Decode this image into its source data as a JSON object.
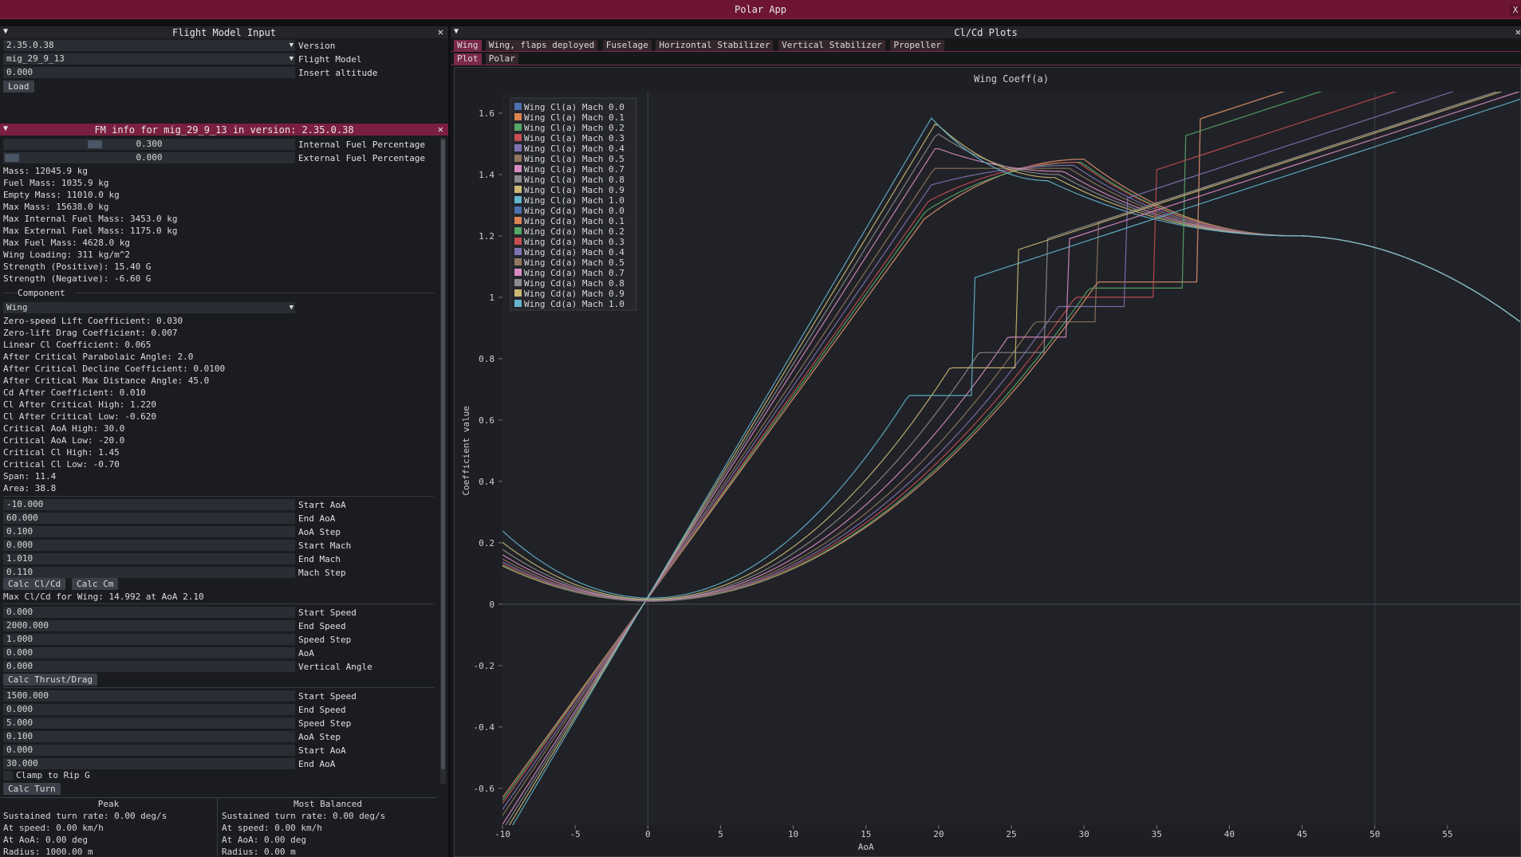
{
  "app": {
    "title": "Polar App",
    "close_glyph": "X"
  },
  "input_panel": {
    "title": "Flight Model Input",
    "version_value": "2.35.0.38",
    "version_label": "Version",
    "fm_value": "mig_29_9_13",
    "fm_label": "Flight Model",
    "altitude_value": "0.000",
    "altitude_label": "Insert altitude",
    "load_label": "Load"
  },
  "fm_panel": {
    "title": "FM info for mig_29_9_13 in version: 2.35.0.38",
    "internal_fuel_value": "0.300",
    "internal_fuel_fraction": 0.3,
    "internal_fuel_label": "Internal Fuel Percentage",
    "external_fuel_value": "0.000",
    "external_fuel_fraction": 0.0,
    "external_fuel_label": "External Fuel Percentage",
    "stats": [
      "Mass: 12045.9 kg",
      "Fuel Mass: 1035.9 kg",
      "Empty Mass: 11010.0 kg",
      "Max Mass: 15638.0 kg",
      "Max Internal Fuel Mass: 3453.0 kg",
      "Max External Fuel Mass: 1175.0 kg",
      "Max Fuel Mass: 4628.0 kg",
      "Wing Loading: 311 kg/m^2",
      "Strength (Positive): 15.40 G",
      "Strength (Negative): -6.60 G"
    ],
    "component_header": "Component",
    "component_value": "Wing",
    "coeffs": [
      "Zero-speed Lift Coefficient: 0.030",
      "Zero-lift Drag Coefficient: 0.007",
      "Linear Cl Coefficient: 0.065",
      "After Critical Parabolaic Angle: 2.0",
      "After Critical Decline Coefficient: 0.0100",
      "After Critical Max Distance Angle: 45.0",
      "Cd After Coefficient: 0.010",
      "Cl After Critical High: 1.220",
      "Cl After Critical Low: -0.620",
      "Critical AoA High: 30.0",
      "Critical AoA Low: -20.0",
      "Critical Cl High: 1.45",
      "Critical Cl Low: -0.70",
      "Span: 11.4",
      "Area: 38.8"
    ],
    "aoa_fields": [
      {
        "value": "-10.000",
        "label": "Start AoA"
      },
      {
        "value": "60.000",
        "label": "End AoA"
      },
      {
        "value": "0.100",
        "label": "AoA Step"
      },
      {
        "value": "0.000",
        "label": "Start Mach"
      },
      {
        "value": "1.010",
        "label": "End Mach"
      },
      {
        "value": "0.110",
        "label": "Mach Step"
      }
    ],
    "calc_clcd_label": "Calc Cl/Cd",
    "calc_cm_label": "Calc Cm",
    "max_clcd_text": "Max Cl/Cd for Wing: 14.992 at AoA 2.10",
    "speed_fields": [
      {
        "value": "0.000",
        "label": "Start Speed"
      },
      {
        "value": "2000.000",
        "label": "End Speed"
      },
      {
        "value": "1.000",
        "label": "Speed Step"
      },
      {
        "value": "0.000",
        "label": "AoA"
      },
      {
        "value": "0.000",
        "label": "Vertical Angle"
      }
    ],
    "calc_thrust_label": "Calc Thrust/Drag",
    "turn_fields": [
      {
        "value": "1500.000",
        "label": "Start Speed"
      },
      {
        "value": "0.000",
        "label": "End Speed"
      },
      {
        "value": "5.000",
        "label": "Speed Step"
      },
      {
        "value": "0.100",
        "label": "AoA Step"
      },
      {
        "value": "0.000",
        "label": "Start AoA"
      },
      {
        "value": "30.000",
        "label": "End AoA"
      }
    ],
    "clamp_label": "Clamp to Rip G",
    "calc_turn_label": "Calc Turn",
    "peak": {
      "header": "Peak",
      "lines": [
        "Sustained turn rate: 0.00 deg/s",
        "At speed: 0.00 km/h",
        "At AoA: 0.00 deg",
        "Radius: 1000.00 m"
      ]
    },
    "balanced": {
      "header": "Most Balanced",
      "lines": [
        "Sustained turn rate: 0.00 deg/s",
        "At speed: 0.00 km/h",
        "At AoA: 0.00 deg",
        "Radius: 0.00 m"
      ]
    }
  },
  "plots_panel": {
    "title": "Cl/Cd Plots",
    "tabs": [
      "Wing",
      "Wing, flaps deployed",
      "Fuselage",
      "Horizontal Stabilizer",
      "Vertical Stabilizer",
      "Propeller"
    ],
    "subtabs": [
      "Plot",
      "Polar"
    ]
  },
  "chart_data": {
    "type": "line",
    "title": "Wing Coeff(a)",
    "xlabel": "AoA",
    "ylabel": "Coefficient value",
    "xlim": [
      -10,
      60
    ],
    "ylim": [
      -0.72,
      1.67
    ],
    "xticks": [
      -10,
      -5,
      0,
      5,
      10,
      15,
      20,
      25,
      30,
      35,
      40,
      45,
      50,
      55
    ],
    "yticks": [
      -0.6,
      -0.4,
      -0.2,
      0,
      0.2,
      0.4,
      0.6,
      0.8,
      1,
      1.2,
      1.4,
      1.6
    ],
    "ytick_labels": [
      "-0.6",
      "-0.4",
      "-0.2",
      "0",
      "0.2",
      "0.4",
      "0.6",
      "0.8",
      "1",
      "1.2",
      "1.4",
      "1.6"
    ],
    "legend_position": "top-left",
    "series": [
      {
        "name": "Wing Cl(a) Mach 0.0",
        "color": "#4c72b0",
        "kind": "cl",
        "peak": 1.45,
        "stall": 30.0,
        "slope": 0.065,
        "shift": 3.0
      },
      {
        "name": "Wing Cl(a) Mach 0.1",
        "color": "#dd8452",
        "kind": "cl",
        "peak": 1.45,
        "stall": 30.0,
        "slope": 0.065,
        "shift": 3.0
      },
      {
        "name": "Wing Cl(a) Mach 0.2",
        "color": "#55a868",
        "kind": "cl",
        "peak": 1.44,
        "stall": 29.8,
        "slope": 0.066,
        "shift": 2.7
      },
      {
        "name": "Wing Cl(a) Mach 0.3",
        "color": "#c44e52",
        "kind": "cl",
        "peak": 1.44,
        "stall": 29.6,
        "slope": 0.067,
        "shift": 2.3
      },
      {
        "name": "Wing Cl(a) Mach 0.4",
        "color": "#8172b3",
        "kind": "cl",
        "peak": 1.43,
        "stall": 29.3,
        "slope": 0.069,
        "shift": 1.8
      },
      {
        "name": "Wing Cl(a) Mach 0.5",
        "color": "#937860",
        "kind": "cl",
        "peak": 1.42,
        "stall": 29.0,
        "slope": 0.071,
        "shift": 1.3
      },
      {
        "name": "Wing Cl(a) Mach 0.7",
        "color": "#da8bc3",
        "kind": "cl",
        "peak": 1.41,
        "stall": 28.6,
        "slope": 0.074,
        "shift": 0.8
      },
      {
        "name": "Wing Cl(a) Mach 0.8",
        "color": "#8c8c8c",
        "kind": "cl",
        "peak": 1.4,
        "stall": 28.3,
        "slope": 0.076,
        "shift": 0.4
      },
      {
        "name": "Wing Cl(a) Mach 0.9",
        "color": "#ccb974",
        "kind": "cl",
        "peak": 1.39,
        "stall": 28.0,
        "slope": 0.078,
        "shift": 0.2
      },
      {
        "name": "Wing Cl(a) Mach 1.0",
        "color": "#64b5cd",
        "kind": "cl",
        "peak": 1.38,
        "stall": 27.5,
        "slope": 0.08,
        "shift": 0.0
      },
      {
        "name": "Wing Cd(a) Mach 0.0",
        "color": "#4c72b0",
        "kind": "cd",
        "k": 0.0011,
        "cd0": 0.01,
        "knee": 38.0,
        "kneeCd": 1.05
      },
      {
        "name": "Wing Cd(a) Mach 0.1",
        "color": "#dd8452",
        "kind": "cd",
        "k": 0.0011,
        "cd0": 0.01,
        "knee": 38.0,
        "kneeCd": 1.05
      },
      {
        "name": "Wing Cd(a) Mach 0.2",
        "color": "#55a868",
        "kind": "cd",
        "k": 0.00112,
        "cd0": 0.01,
        "knee": 37.0,
        "kneeCd": 1.03
      },
      {
        "name": "Wing Cd(a) Mach 0.3",
        "color": "#c44e52",
        "kind": "cd",
        "k": 0.00116,
        "cd0": 0.011,
        "knee": 35.0,
        "kneeCd": 1.0
      },
      {
        "name": "Wing Cd(a) Mach 0.4",
        "color": "#8172b3",
        "kind": "cd",
        "k": 0.00122,
        "cd0": 0.011,
        "knee": 33.0,
        "kneeCd": 0.97
      },
      {
        "name": "Wing Cd(a) Mach 0.5",
        "color": "#937860",
        "kind": "cd",
        "k": 0.0013,
        "cd0": 0.012,
        "knee": 31.0,
        "kneeCd": 0.92
      },
      {
        "name": "Wing Cd(a) Mach 0.7",
        "color": "#da8bc3",
        "kind": "cd",
        "k": 0.00142,
        "cd0": 0.013,
        "knee": 29.0,
        "kneeCd": 0.87
      },
      {
        "name": "Wing Cd(a) Mach 0.8",
        "color": "#8c8c8c",
        "kind": "cd",
        "k": 0.00158,
        "cd0": 0.014,
        "knee": 27.5,
        "kneeCd": 0.82
      },
      {
        "name": "Wing Cd(a) Mach 0.9",
        "color": "#ccb974",
        "kind": "cd",
        "k": 0.00178,
        "cd0": 0.016,
        "knee": 25.5,
        "kneeCd": 0.77
      },
      {
        "name": "Wing Cd(a) Mach 1.0",
        "color": "#64b5cd",
        "kind": "cd",
        "k": 0.0021,
        "cd0": 0.02,
        "knee": 22.5,
        "kneeCd": 0.68
      }
    ]
  }
}
